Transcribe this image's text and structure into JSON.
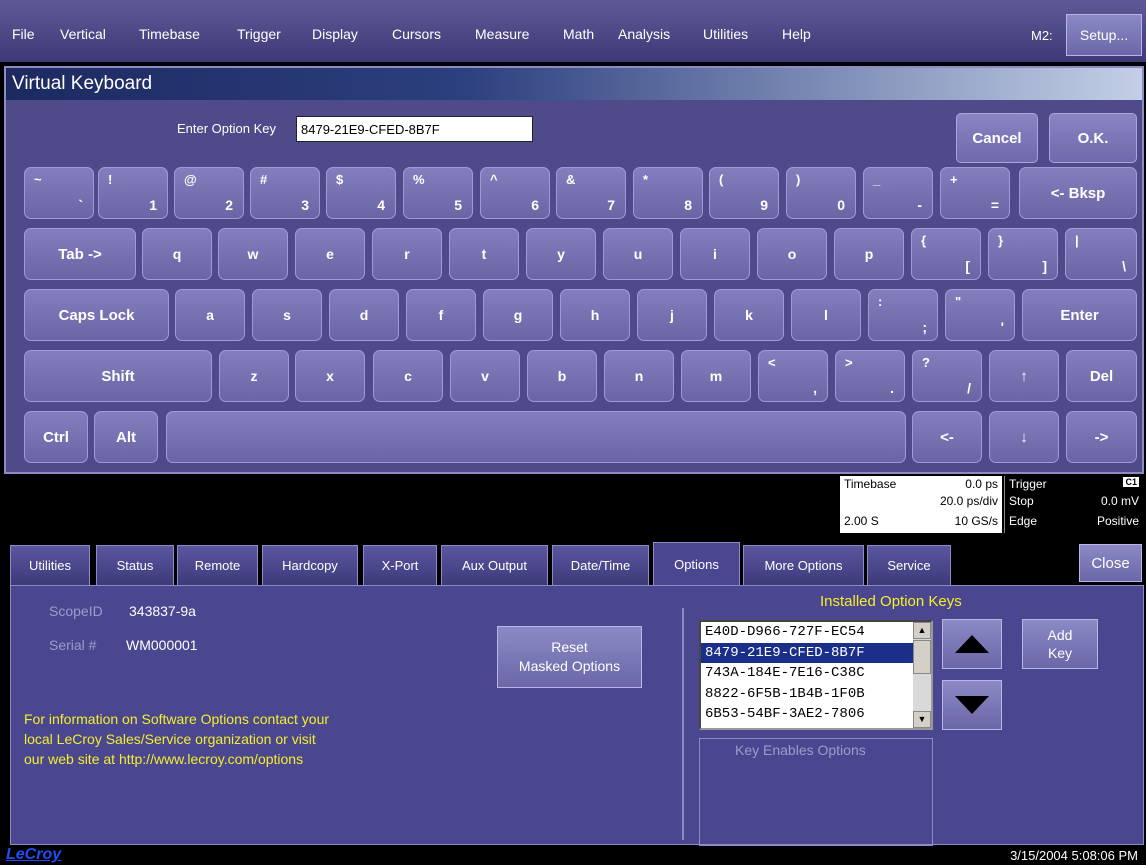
{
  "menubar": {
    "items": [
      "File",
      "Vertical",
      "Timebase",
      "Trigger",
      "Display",
      "Cursors",
      "Measure",
      "Math",
      "Analysis",
      "Utilities",
      "Help"
    ],
    "indicator": "M2:",
    "setup_label": "Setup..."
  },
  "keyboard": {
    "title": "Virtual Keyboard",
    "option_label": "Enter Option Key",
    "option_value": "8479-21E9-CFED-8B7F",
    "cancel_label": "Cancel",
    "ok_label": "O.K.",
    "row1": [
      {
        "up": "~",
        "lo": "`"
      },
      {
        "up": "!",
        "lo": "1"
      },
      {
        "up": "@",
        "lo": "2"
      },
      {
        "up": "#",
        "lo": "3"
      },
      {
        "up": "$",
        "lo": "4"
      },
      {
        "up": "%",
        "lo": "5"
      },
      {
        "up": "^",
        "lo": "6"
      },
      {
        "up": "&",
        "lo": "7"
      },
      {
        "up": "*",
        "lo": "8"
      },
      {
        "up": "(",
        "lo": "9"
      },
      {
        "up": ")",
        "lo": "0"
      },
      {
        "up": "_",
        "lo": "-"
      },
      {
        "up": "+",
        "lo": "="
      }
    ],
    "bksp": "<- Bksp",
    "tab": "Tab ->",
    "row2": [
      "q",
      "w",
      "e",
      "r",
      "t",
      "y",
      "u",
      "i",
      "o",
      "p"
    ],
    "row2b": [
      {
        "up": "{",
        "lo": "["
      },
      {
        "up": "}",
        "lo": "]"
      },
      {
        "up": "|",
        "lo": "\\"
      }
    ],
    "caps": "Caps Lock",
    "row3": [
      "a",
      "s",
      "d",
      "f",
      "g",
      "h",
      "j",
      "k",
      "l"
    ],
    "row3b": [
      {
        "up": ":",
        "lo": ";"
      },
      {
        "up": "\"",
        "lo": "'"
      }
    ],
    "enter": "Enter",
    "shift": "Shift",
    "row4": [
      "z",
      "x",
      "c",
      "v",
      "b",
      "n",
      "m"
    ],
    "row4b": [
      {
        "up": "<",
        "lo": ","
      },
      {
        "up": ">",
        "lo": "."
      },
      {
        "up": "?",
        "lo": "/"
      }
    ],
    "up_arrow": "↑",
    "del": "Del",
    "ctrl": "Ctrl",
    "alt": "Alt",
    "left_arrow": "<-",
    "down_arrow": "↓",
    "right_arrow": "->"
  },
  "status": {
    "timebase_label": "Timebase",
    "timebase_delay": "0.0 ps",
    "timebase_div": "20.0 ps/div",
    "timebase_time": "2.00 S",
    "timebase_rate": "10 GS/s",
    "trigger_label": "Trigger",
    "trigger_channel": "C1",
    "trigger_mode": "Stop",
    "trigger_level": "0.0 mV",
    "trigger_type": "Edge",
    "trigger_slope": "Positive"
  },
  "tabs": [
    "Utilities",
    "Status",
    "Remote",
    "Hardcopy",
    "X-Port",
    "Aux Output",
    "Date/Time",
    "Options",
    "More Options",
    "Service"
  ],
  "active_tab": "Options",
  "close_label": "Close",
  "options": {
    "scope_id_label": "ScopeID",
    "scope_id": "343837-9a",
    "serial_label": "Serial #",
    "serial": "WM000001",
    "reset_line1": "Reset",
    "reset_line2": "Masked Options",
    "info_line1": "For information on Software Options contact your",
    "info_line2": "local LeCroy Sales/Service organization or visit",
    "info_line3": "our web site at http://www.lecroy.com/options",
    "keys_title": "Installed Option Keys",
    "keys": [
      "E40D-D966-727F-EC54",
      "8479-21E9-CFED-8B7F",
      "743A-184E-7E16-C38C",
      "8822-6F5B-1B4B-1F0B",
      "6B53-54BF-3AE2-7806"
    ],
    "selected_key": "8479-21E9-CFED-8B7F",
    "key_enables_label": "Key Enables Options",
    "add_line1": "Add",
    "add_line2": "Key"
  },
  "footer": {
    "logo": "LeCroy",
    "datetime": "3/15/2004 5:08:06 PM"
  }
}
